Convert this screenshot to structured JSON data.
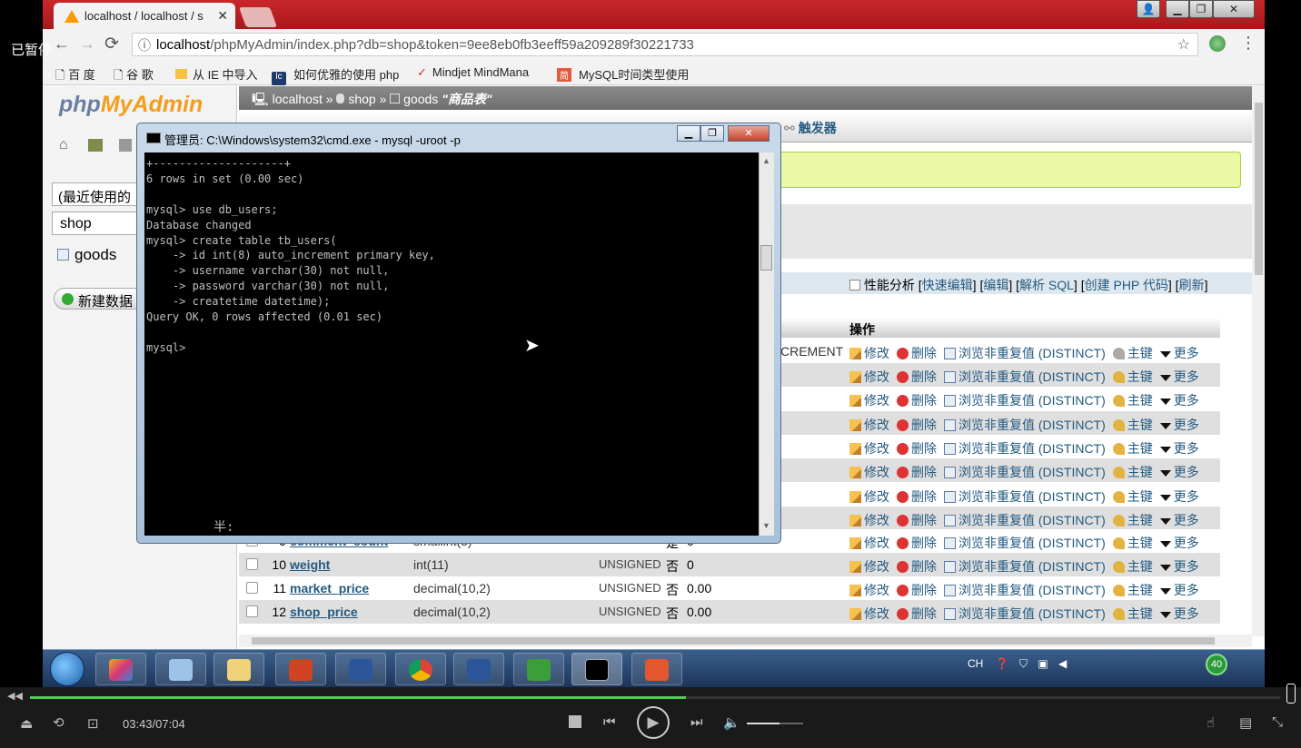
{
  "browser": {
    "tab_title": "localhost / localhost / s",
    "url_host": "localhost",
    "url_path": "/phpMyAdmin/index.php?db=shop&token=9ee8eb0fb3eeff59a209289f30221733",
    "bookmarks": [
      "百 度",
      "谷 歌",
      "从 IE 中导入",
      "如何优雅的使用 php",
      "Mindjet MindMana",
      "MySQL时间类型使用"
    ]
  },
  "player_overlay": {
    "paused_label": "已暂停"
  },
  "pma": {
    "logo_php": "php",
    "logo_myadmin": "MyAdmin",
    "recent": "(最近使用的",
    "db_select": "shop",
    "table_item": "goods",
    "new_data": "新建数据",
    "breadcrumb": {
      "server": "localhost",
      "db": "shop",
      "table": "goods",
      "comment": "\"商品表\"",
      "sep": "»"
    },
    "tab_triggers": "触发器",
    "toolline": {
      "profiling": "性能分析",
      "open": "[",
      "quick_edit": "快速编辑",
      "close_open": "] [",
      "edit": "编辑",
      "explain": "解析 SQL",
      "create_php": "创建 PHP 代码",
      "refresh": "刷新",
      "close": "]"
    },
    "ops_header": "操作",
    "first_row_extra": "CREMENT",
    "actions": {
      "edit": "修改",
      "delete": "删除",
      "distinct": "浏览非重复值 (DISTINCT)",
      "primary": "主键",
      "more": "更多"
    },
    "rows": [
      {
        "num": "9",
        "name": "comment_count",
        "type": "smallint(5)",
        "attr": "",
        "null": "是",
        "default": "0"
      },
      {
        "num": "10",
        "name": "weight",
        "type": "int(11)",
        "attr": "UNSIGNED",
        "null": "否",
        "default": "0"
      },
      {
        "num": "11",
        "name": "market_price",
        "type": "decimal(10,2)",
        "attr": "UNSIGNED",
        "null": "否",
        "default": "0.00"
      },
      {
        "num": "12",
        "name": "shop_price",
        "type": "decimal(10,2)",
        "attr": "UNSIGNED",
        "null": "否",
        "default": "0.00"
      }
    ]
  },
  "cmd": {
    "title": "管理员: C:\\Windows\\system32\\cmd.exe - mysql  -uroot -p",
    "lines": [
      "+--------------------+",
      "6 rows in set (0.00 sec)",
      "",
      "mysql> use db_users;",
      "Database changed",
      "mysql> create table tb_users(",
      "    -> id int(8) auto_increment primary key,",
      "    -> username varchar(30) not null,",
      "    -> password varchar(30) not null,",
      "    -> createtime datetime);",
      "Query OK, 0 rows affected (0.01 sec)",
      "",
      "mysql>"
    ],
    "ime": "半:"
  },
  "tray": {
    "lang": "CH",
    "badge": "40"
  },
  "player": {
    "time": "03:43/07:04",
    "progress_fraction": 0.525
  }
}
